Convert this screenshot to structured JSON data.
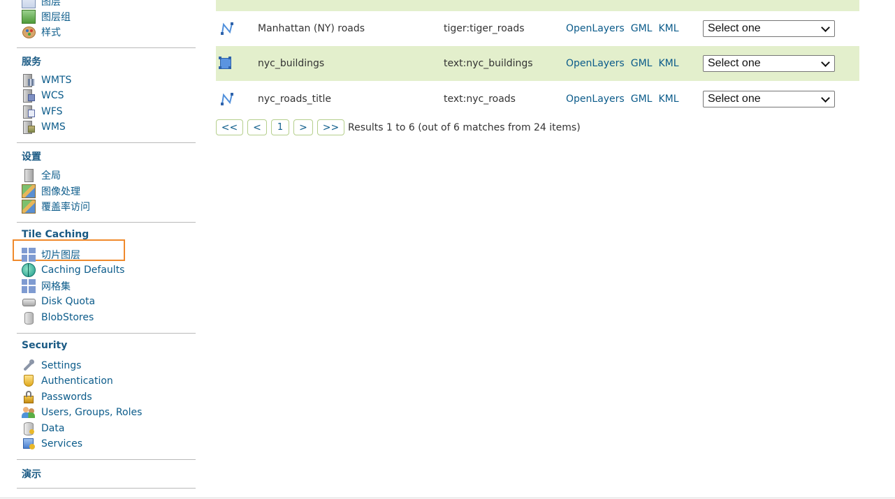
{
  "sidebar": {
    "top_items": [
      {
        "label": "图层",
        "icon": "layer-icon"
      },
      {
        "label": "图层组",
        "icon": "layer-group-icon"
      },
      {
        "label": "样式",
        "icon": "style-palette-icon"
      }
    ],
    "services_title": "服务",
    "services": [
      {
        "label": "WMTS",
        "icon": "wmts-icon"
      },
      {
        "label": "WCS",
        "icon": "wcs-icon"
      },
      {
        "label": "WFS",
        "icon": "wfs-icon"
      },
      {
        "label": "WMS",
        "icon": "wms-icon"
      }
    ],
    "settings_title": "设置",
    "settings": [
      {
        "label": "全局",
        "icon": "server-icon"
      },
      {
        "label": "图像处理",
        "icon": "image-icon"
      },
      {
        "label": "覆盖率访问",
        "icon": "image-icon"
      }
    ],
    "tile_caching_title": "Tile Caching",
    "tile_caching": [
      {
        "label": "切片图层",
        "icon": "grid-icon"
      },
      {
        "label": "Caching Defaults",
        "icon": "globe-icon"
      },
      {
        "label": "网格集",
        "icon": "grid-icon"
      },
      {
        "label": "Disk Quota",
        "icon": "disk-icon"
      },
      {
        "label": "BlobStores",
        "icon": "blob-icon"
      }
    ],
    "security_title": "Security",
    "security": [
      {
        "label": "Settings",
        "icon": "wrench-icon"
      },
      {
        "label": "Authentication",
        "icon": "shield-icon"
      },
      {
        "label": "Passwords",
        "icon": "lock-icon"
      },
      {
        "label": "Users, Groups, Roles",
        "icon": "users-icon"
      },
      {
        "label": "Data",
        "icon": "database-icon"
      },
      {
        "label": "Services",
        "icon": "services-icon"
      }
    ],
    "demo_title": "演示"
  },
  "table": {
    "rows": [
      {
        "name": "Manhattan (NY) roads",
        "workspace_layer": "tiger:tiger_roads",
        "type_icon": "line-layer-icon",
        "links": [
          "OpenLayers",
          "GML",
          "KML"
        ],
        "select_value": "Select one"
      },
      {
        "name": "nyc_buildings",
        "workspace_layer": "text:nyc_buildings",
        "type_icon": "polygon-layer-icon",
        "links": [
          "OpenLayers",
          "GML",
          "KML"
        ],
        "select_value": "Select one"
      },
      {
        "name": "nyc_roads_title",
        "workspace_layer": "text:nyc_roads",
        "type_icon": "line-layer-icon",
        "links": [
          "OpenLayers",
          "GML",
          "KML"
        ],
        "select_value": "Select one"
      }
    ]
  },
  "pager": {
    "first": "<<",
    "prev": "<",
    "current": "1",
    "next": ">",
    "last": ">>",
    "results": "Results 1 to 6 (out of 6 matches from 24 items)"
  },
  "colors": {
    "link": "#0b5b8a",
    "row_alt": "#e3efcc",
    "highlight": "#f08a2c"
  }
}
